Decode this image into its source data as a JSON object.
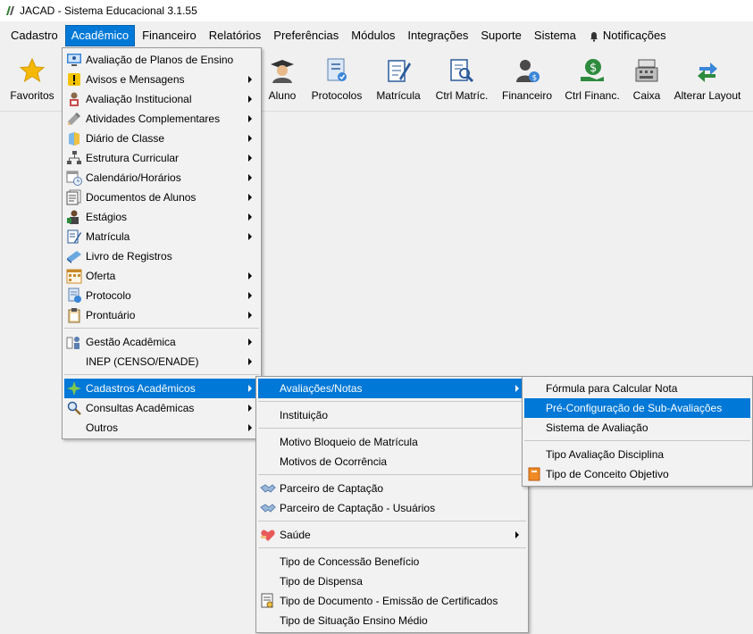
{
  "window": {
    "title": "JACAD - Sistema Educacional 3.1.55"
  },
  "menubar": {
    "items": [
      "Cadastro",
      "Acadêmico",
      "Financeiro",
      "Relatórios",
      "Preferências",
      "Módulos",
      "Integrações",
      "Suporte",
      "Sistema"
    ],
    "notifications": "Notificações",
    "active": "Acadêmico"
  },
  "toolbar": {
    "favoritos": "Favoritos",
    "aluno": "Aluno",
    "protocolos": "Protocolos",
    "matricula": "Matrícula",
    "ctrl_matric": "Ctrl Matríc.",
    "financeiro": "Financeiro",
    "ctrl_financ": "Ctrl Financ.",
    "caixa": "Caixa",
    "alterar_layout": "Alterar Layout"
  },
  "academico_menu": [
    "Avaliação de Planos de Ensino",
    "Avisos e Mensagens",
    "Avaliação Institucional",
    "Atividades Complementares",
    "Diário de Classe",
    "Estrutura Curricular",
    "Calendário/Horários",
    "Documentos de Alunos",
    "Estágios",
    "Matrícula",
    "Livro de Registros",
    "Oferta",
    "Protocolo",
    "Prontuário",
    "Gestão Acadêmica",
    "INEP (CENSO/ENADE)",
    "Cadastros Acadêmicos",
    "Consultas Acadêmicas",
    "Outros"
  ],
  "cadastros_menu": [
    "Avaliações/Notas",
    "Instituição",
    "Motivo Bloqueio de Matrícula",
    "Motivos de Ocorrência",
    "Parceiro de Captação",
    "Parceiro de Captação - Usuários",
    "Saúde",
    "Tipo de Concessão Benefício",
    "Tipo de Dispensa",
    "Tipo de Documento - Emissão de Certificados",
    "Tipo de Situação Ensino Médio"
  ],
  "avaliacoes_menu": [
    "Fórmula para Calcular Nota",
    "Pré-Configuração de Sub-Avaliações",
    "Sistema de Avaliação",
    "Tipo Avaliação Disciplina",
    "Tipo de Conceito Objetivo"
  ],
  "colors": {
    "highlight": "#0078d7",
    "menu_bg": "#f2f2f2"
  }
}
